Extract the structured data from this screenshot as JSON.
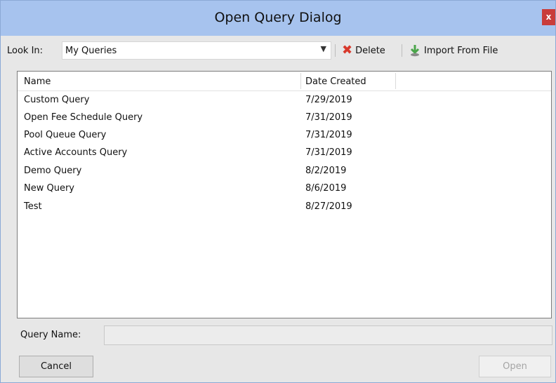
{
  "window": {
    "title": "Open Query Dialog",
    "close_label": "x"
  },
  "toolbar": {
    "look_in_label": "Look In:",
    "look_in_value": "My Queries",
    "dropdown_arrow": "▼",
    "delete_label": "Delete",
    "import_label": "Import From File"
  },
  "list": {
    "columns": [
      "Name",
      "Date Created"
    ],
    "rows": [
      {
        "name": "Custom Query",
        "date": "7/29/2019"
      },
      {
        "name": "Open Fee Schedule Query",
        "date": "7/31/2019"
      },
      {
        "name": "Pool Queue Query",
        "date": "7/31/2019"
      },
      {
        "name": "Active Accounts Query",
        "date": "7/31/2019"
      },
      {
        "name": "Demo Query",
        "date": "8/2/2019"
      },
      {
        "name": "New Query",
        "date": "8/6/2019"
      },
      {
        "name": "Test",
        "date": "8/27/2019"
      }
    ]
  },
  "query_name": {
    "label": "Query Name:",
    "value": ""
  },
  "buttons": {
    "cancel": "Cancel",
    "open": "Open"
  },
  "colors": {
    "titlebar": "#a7c3ee",
    "close": "#c93c3b",
    "delete_icon": "#d8392c",
    "import_icon": "#4aa54a"
  },
  "icons": {
    "close": "close-icon",
    "dropdown": "dropdown-arrow-icon",
    "delete": "delete-x-icon",
    "import": "import-file-icon"
  }
}
